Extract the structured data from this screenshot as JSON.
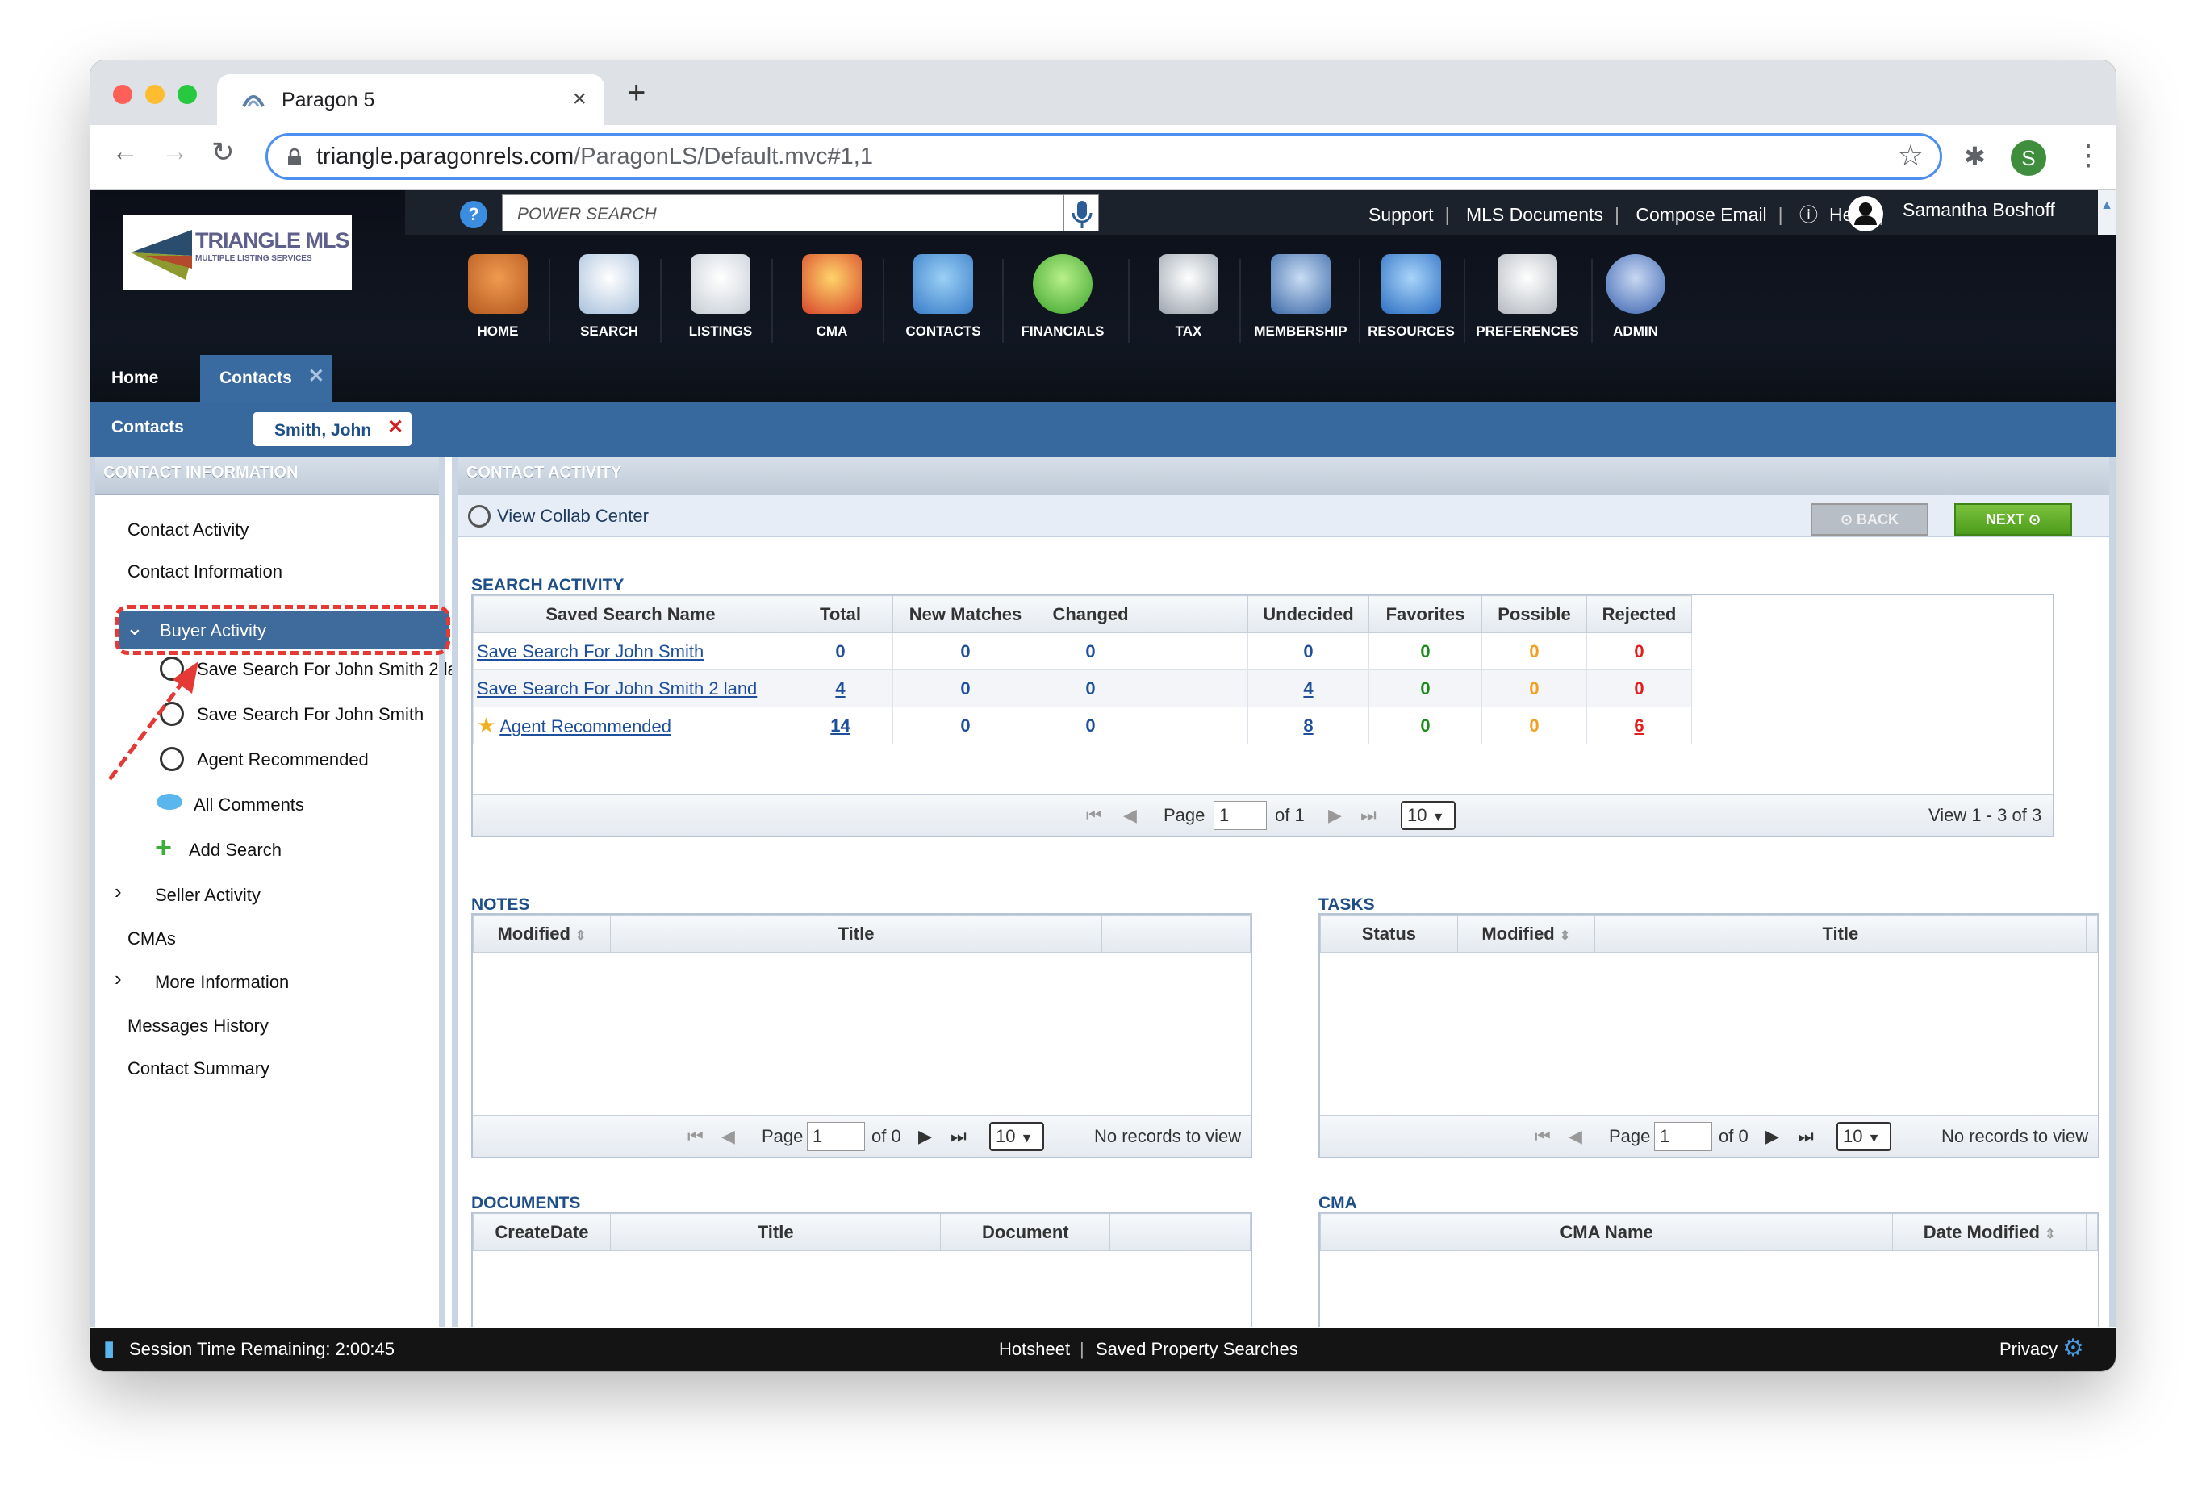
{
  "browser": {
    "tab_title": "Paragon 5",
    "url_host": "triangle.paragonrels.com",
    "url_path": "/ParagonLS/Default.mvc#1,1",
    "profile_initial": "S"
  },
  "header": {
    "logo_title": "TRIANGLE MLS",
    "logo_sub": "MULTIPLE LISTING SERVICES",
    "search_placeholder": "POWER SEARCH",
    "links": [
      "Support",
      "MLS Documents",
      "Compose Email",
      "Help"
    ],
    "user_name": "Samantha Boshoff",
    "nav_icons": [
      "HOME",
      "SEARCH",
      "LISTINGS",
      "CMA",
      "CONTACTS",
      "FINANCIALS",
      "TAX",
      "MEMBERSHIP",
      "RESOURCES",
      "PREFERENCES",
      "ADMIN"
    ]
  },
  "tabs": {
    "home": "Home",
    "contacts": "Contacts",
    "sub_contacts": "Contacts",
    "sub_contact_name": "Smith, John"
  },
  "left": {
    "header": "CONTACT INFORMATION",
    "items": {
      "contact_activity": "Contact Activity",
      "contact_information": "Contact Information",
      "buyer_activity": "Buyer Activity",
      "search1": "Save Search For John Smith 2 la",
      "search2": "Save Search For John Smith",
      "agent_rec": "Agent Recommended",
      "all_comments": "All Comments",
      "add_search": "Add Search",
      "seller_activity": "Seller Activity",
      "cmas": "CMAs",
      "more_info": "More Information",
      "messages_history": "Messages History",
      "contact_summary": "Contact Summary"
    }
  },
  "right": {
    "header": "CONTACT ACTIVITY",
    "view_collab": "View Collab Center",
    "back": "BACK",
    "next": "NEXT",
    "search_activity": {
      "title": "SEARCH ACTIVITY",
      "columns": [
        "Saved Search Name",
        "Total",
        "New Matches",
        "Changed",
        "",
        "Undecided",
        "Favorites",
        "Possible",
        "Rejected"
      ],
      "rows": [
        {
          "name": "Save Search For John Smith",
          "total": "0",
          "new": "0",
          "changed": "0",
          "undecided": "0",
          "favorites": "0",
          "possible": "0",
          "rejected": "0"
        },
        {
          "name": "Save Search For John Smith 2 land",
          "total": "4",
          "new": "0",
          "changed": "0",
          "undecided": "4",
          "favorites": "0",
          "possible": "0",
          "rejected": "0"
        },
        {
          "name": "Agent Recommended",
          "total": "14",
          "new": "0",
          "changed": "0",
          "undecided": "8",
          "favorites": "0",
          "possible": "0",
          "rejected": "6"
        }
      ],
      "page_label": "Page",
      "page_value": "1",
      "of_label": "of 1",
      "per_page": "10",
      "view_text": "View 1 - 3 of 3"
    },
    "notes": {
      "title": "NOTES",
      "columns": [
        "Modified",
        "Title"
      ],
      "page_label": "Page",
      "page_value": "1",
      "of_label": "of 0",
      "per_page": "10",
      "empty": "No records to view"
    },
    "tasks": {
      "title": "TASKS",
      "columns": [
        "Status",
        "Modified",
        "Title"
      ],
      "page_label": "Page",
      "page_value": "1",
      "of_label": "of 0",
      "per_page": "10",
      "empty": "No records to view"
    },
    "documents": {
      "title": "DOCUMENTS",
      "columns": [
        "CreateDate",
        "Title",
        "Document"
      ]
    },
    "cma": {
      "title": "CMA",
      "columns": [
        "CMA Name",
        "Date Modified"
      ]
    }
  },
  "status_bar": {
    "session": "Session Time Remaining: 2:00:45",
    "hotsheet": "Hotsheet",
    "saved": "Saved Property Searches",
    "privacy": "Privacy"
  },
  "colors": {
    "nav_blue": "#38699e",
    "link_blue": "#1e4f9c",
    "green": "#1b8a1b",
    "orange": "#f2a020",
    "red": "#e02020"
  }
}
